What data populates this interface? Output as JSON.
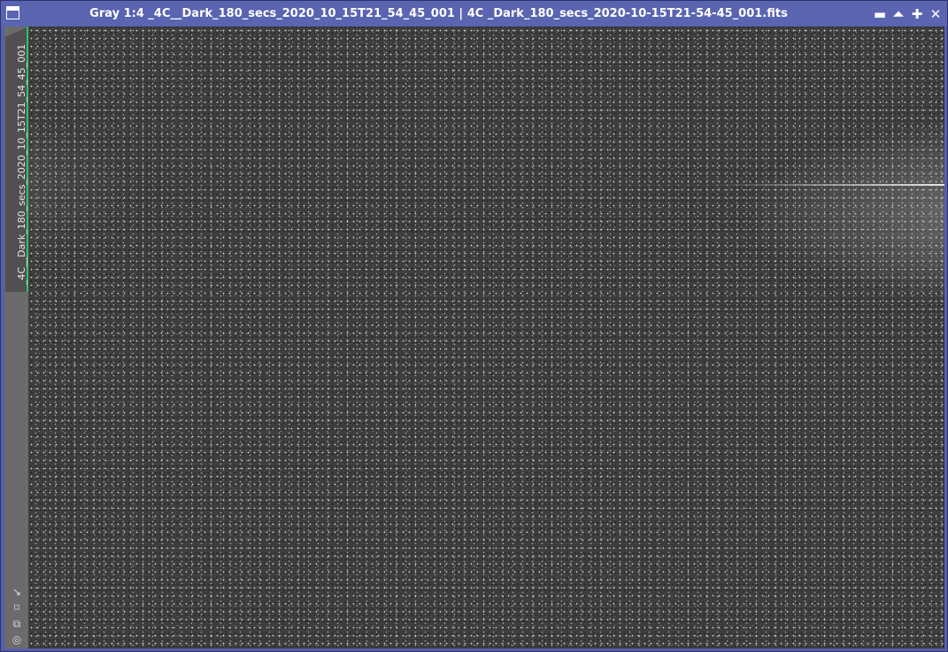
{
  "window": {
    "title": "Gray 1:4 _4C__Dark_180_secs_2020_10_15T21_54_45_001 | 4C _Dark_180_secs_2020-10-15T21-54-45_001.fits",
    "controls": {
      "minimize": "▬",
      "shade": "⏶",
      "maximize": "✚",
      "close": "✕"
    }
  },
  "sidebar": {
    "view_tab_label": "_4C__Dark_180_secs_2020_10_15T21_54_45_001",
    "tools": [
      {
        "icon": "arrow-down-right-icon",
        "glyph": "↘"
      },
      {
        "icon": "fit-view-icon",
        "glyph": "⌑"
      },
      {
        "icon": "clone-view-icon",
        "glyph": "⧉"
      },
      {
        "icon": "target-icon",
        "glyph": "◎"
      }
    ]
  },
  "colors": {
    "titlebar": "#5a64b0",
    "tab_indicator": "#2ec26a",
    "image_background": "#3f3f3f"
  }
}
